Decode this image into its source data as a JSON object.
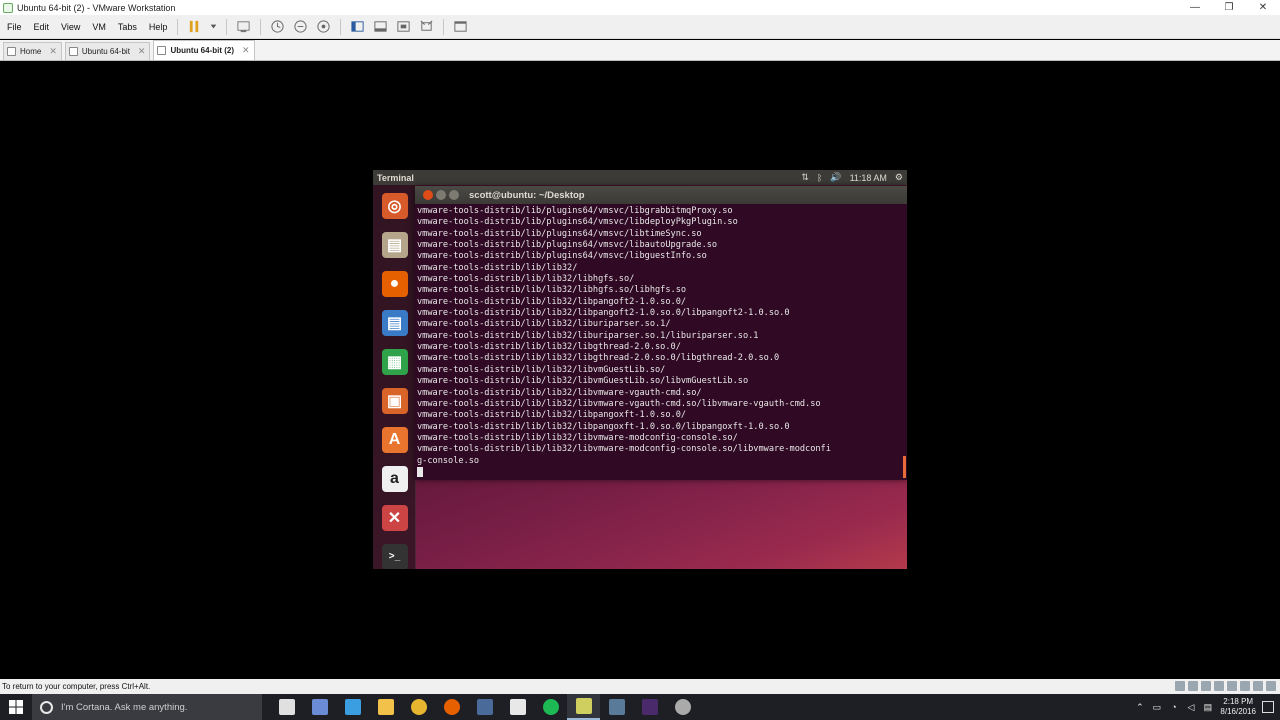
{
  "window": {
    "title": "Ubuntu 64-bit (2) - VMware Workstation",
    "minimize_glyph": "—",
    "restore_glyph": "❐",
    "close_glyph": "✕"
  },
  "menu": [
    "File",
    "Edit",
    "View",
    "VM",
    "Tabs",
    "Help"
  ],
  "tabs": [
    {
      "label": "Home",
      "active": false
    },
    {
      "label": "Ubuntu 64-bit",
      "active": false
    },
    {
      "label": "Ubuntu 64-bit (2)",
      "active": true
    }
  ],
  "tab_close_glyph": "✕",
  "ubuntu": {
    "app_title": "Terminal",
    "tray": {
      "network_glyph": "⇅",
      "bluetooth_glyph": "ᛒ",
      "volume_glyph": "🔊",
      "time": "11:18 AM",
      "settings_glyph": "⚙"
    },
    "launcher": [
      {
        "name": "ubuntu-dash",
        "glyph": "◎",
        "color": "#d65a2a"
      },
      {
        "name": "files",
        "glyph": "▤",
        "color": "#b5a58a"
      },
      {
        "name": "firefox",
        "glyph": "●",
        "color": "#e66000"
      },
      {
        "name": "libreoffice-writer",
        "glyph": "▤",
        "color": "#3a7bc8"
      },
      {
        "name": "libreoffice-calc",
        "glyph": "▦",
        "color": "#2fa24a"
      },
      {
        "name": "libreoffice-impress",
        "glyph": "▣",
        "color": "#d8642a"
      },
      {
        "name": "software-center",
        "glyph": "A",
        "color": "#e8742e"
      },
      {
        "name": "amazon",
        "glyph": "a",
        "color": "#f0f0f0"
      },
      {
        "name": "system-settings",
        "glyph": "✕",
        "color": "#c44"
      },
      {
        "name": "terminal",
        "glyph": ">_",
        "color": "#333"
      }
    ]
  },
  "terminal": {
    "title": "scott@ubuntu: ~/Desktop",
    "lines": [
      "vmware-tools-distrib/lib/plugins64/vmsvc/libgrabbitmqProxy.so",
      "vmware-tools-distrib/lib/plugins64/vmsvc/libdeployPkgPlugin.so",
      "vmware-tools-distrib/lib/plugins64/vmsvc/libtimeSync.so",
      "vmware-tools-distrib/lib/plugins64/vmsvc/libautoUpgrade.so",
      "vmware-tools-distrib/lib/plugins64/vmsvc/libguestInfo.so",
      "vmware-tools-distrib/lib/lib32/",
      "vmware-tools-distrib/lib/lib32/libhgfs.so/",
      "vmware-tools-distrib/lib/lib32/libhgfs.so/libhgfs.so",
      "vmware-tools-distrib/lib/lib32/libpangoft2-1.0.so.0/",
      "vmware-tools-distrib/lib/lib32/libpangoft2-1.0.so.0/libpangoft2-1.0.so.0",
      "vmware-tools-distrib/lib/lib32/liburiparser.so.1/",
      "vmware-tools-distrib/lib/lib32/liburiparser.so.1/liburiparser.so.1",
      "vmware-tools-distrib/lib/lib32/libgthread-2.0.so.0/",
      "vmware-tools-distrib/lib/lib32/libgthread-2.0.so.0/libgthread-2.0.so.0",
      "vmware-tools-distrib/lib/lib32/libvmGuestLib.so/",
      "vmware-tools-distrib/lib/lib32/libvmGuestLib.so/libvmGuestLib.so",
      "vmware-tools-distrib/lib/lib32/libvmware-vgauth-cmd.so/",
      "vmware-tools-distrib/lib/lib32/libvmware-vgauth-cmd.so/libvmware-vgauth-cmd.so",
      "vmware-tools-distrib/lib/lib32/libpangoxft-1.0.so.0/",
      "vmware-tools-distrib/lib/lib32/libpangoxft-1.0.so.0/libpangoxft-1.0.so.0",
      "vmware-tools-distrib/lib/lib32/libvmware-modconfig-console.so/",
      "vmware-tools-distrib/lib/lib32/libvmware-modconfig-console.so/libvmware-modconfi",
      "g-console.so"
    ]
  },
  "statusbar": {
    "text": "To return to your computer, press Ctrl+Alt."
  },
  "taskbar": {
    "cortana_placeholder": "I'm Cortana. Ask me anything.",
    "apps": [
      {
        "name": "task-view",
        "color": "#e0e0e0",
        "active": false
      },
      {
        "name": "vmware",
        "color": "#6b8bd6",
        "active": false
      },
      {
        "name": "store",
        "color": "#3a9ee0",
        "active": false
      },
      {
        "name": "file-explorer",
        "color": "#f2c14a",
        "active": false
      },
      {
        "name": "chrome",
        "color": "#e8b530",
        "active": false
      },
      {
        "name": "firefox",
        "color": "#e66000",
        "active": false
      },
      {
        "name": "steam",
        "color": "#4a6a9a",
        "active": false
      },
      {
        "name": "mail",
        "color": "#e8e8e8",
        "active": false
      },
      {
        "name": "spotify",
        "color": "#1db954",
        "active": false
      },
      {
        "name": "vmware-workstation",
        "color": "#cfcf60",
        "active": true
      },
      {
        "name": "unknown-app",
        "color": "#5a7a9a",
        "active": false
      },
      {
        "name": "premiere",
        "color": "#4b2a6b",
        "active": false
      },
      {
        "name": "obs",
        "color": "#aaaaaa",
        "active": false
      }
    ],
    "up_arrow_glyph": "⌃",
    "time": "2:18 PM",
    "date": "8/16/2016"
  }
}
